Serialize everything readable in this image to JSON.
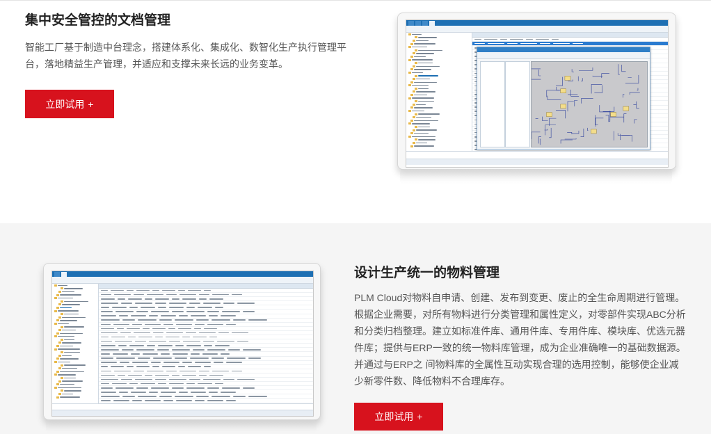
{
  "features": [
    {
      "title": "集中安全管控的文档管理",
      "description": "智能工厂基于制造中台理念，搭建体系化、集成化、数智化生产执行管理平台，落地精益生产管理，并适应和支撑未来长远的业务变革。",
      "cta": {
        "label": "立即试用",
        "suffix": "+"
      },
      "screenshot_icon": "document-management-screenshot"
    },
    {
      "title": "设计生产统一的物料管理",
      "description": "PLM Cloud对物料自申请、创建、发布到变更、废止的全生命周期进行管理。根据企业需要，对所有物料进行分类管理和属性定义，对零部件实现ABC分析和分类归档整理。建立如标准件库、通用件库、专用件库、模块库、优选元器件库；提供与ERP一致的统一物料库管理，成为企业准确唯一的基础数据源。并通过与ERP之 间物料库的全属性互动实现合理的选用控制，能够使企业减少新零件数、降低物料不合理库存。",
      "cta": {
        "label": "立即试用",
        "suffix": "+"
      },
      "screenshot_icon": "material-management-screenshot"
    }
  ],
  "colors": {
    "accent": "#d7121d",
    "section_alt_bg": "#f5f5f5",
    "app_blue": "#1d6fb3"
  }
}
